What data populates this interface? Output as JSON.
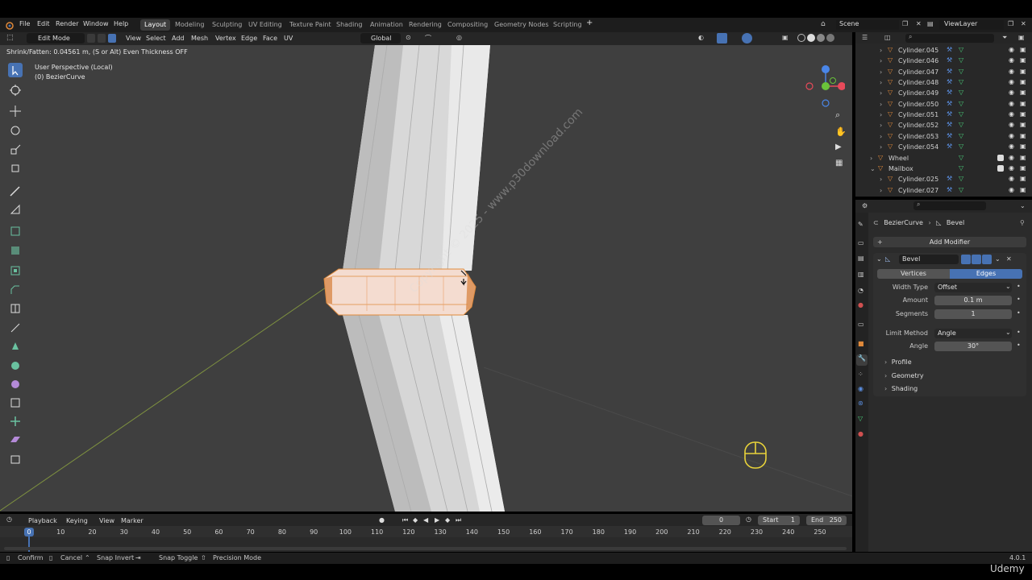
{
  "menus": [
    "File",
    "Edit",
    "Render",
    "Window",
    "Help"
  ],
  "workspace_tabs": [
    "Layout",
    "Modeling",
    "Sculpting",
    "UV Editing",
    "Texture Paint",
    "Shading",
    "Animation",
    "Rendering",
    "Compositing",
    "Geometry Nodes",
    "Scripting"
  ],
  "active_tab": "Layout",
  "scene": "Scene",
  "view_layer": "ViewLayer",
  "viewport_header": {
    "mode": "Edit Mode",
    "menus": [
      "View",
      "Select",
      "Add",
      "Mesh",
      "Vertex",
      "Edge",
      "Face",
      "UV"
    ],
    "orientation": "Global"
  },
  "operator_info": "Shrink/Fatten: 0.04561 m, (S or Alt) Even Thickness OFF",
  "viewport_info": {
    "perspective": "User Perspective (Local)",
    "object": "(0) BezierCurve"
  },
  "watermark": "Copyright © 2025 - www.p30download.com",
  "outliner": [
    {
      "name": "Cylinder.045",
      "type": "mesh"
    },
    {
      "name": "Cylinder.046",
      "type": "mesh"
    },
    {
      "name": "Cylinder.047",
      "type": "mesh"
    },
    {
      "name": "Cylinder.048",
      "type": "mesh"
    },
    {
      "name": "Cylinder.049",
      "type": "mesh"
    },
    {
      "name": "Cylinder.050",
      "type": "mesh"
    },
    {
      "name": "Cylinder.051",
      "type": "mesh"
    },
    {
      "name": "Cylinder.052",
      "type": "mesh"
    },
    {
      "name": "Cylinder.053",
      "type": "mesh"
    },
    {
      "name": "Cylinder.054",
      "type": "mesh"
    },
    {
      "name": "Wheel",
      "type": "collection"
    },
    {
      "name": "Mailbox",
      "type": "collection"
    },
    {
      "name": "Cylinder.025",
      "type": "mesh"
    },
    {
      "name": "Cylinder.027",
      "type": "mesh"
    }
  ],
  "properties": {
    "breadcrumb_object": "BezierCurve",
    "breadcrumb_modifier": "Bevel",
    "add_modifier": "Add Modifier",
    "modifier_name": "Bevel",
    "affect_vertices": "Vertices",
    "affect_edges": "Edges",
    "width_type_label": "Width Type",
    "width_type": "Offset",
    "amount_label": "Amount",
    "amount": "0.1 m",
    "segments_label": "Segments",
    "segments": "1",
    "limit_method_label": "Limit Method",
    "limit_method": "Angle",
    "angle_label": "Angle",
    "angle": "30°",
    "panels": [
      "Profile",
      "Geometry",
      "Shading"
    ]
  },
  "timeline": {
    "menus": [
      "Playback",
      "Keying",
      "View",
      "Marker"
    ],
    "current_frame": "0",
    "start_label": "Start",
    "start": "1",
    "end_label": "End",
    "end": "250",
    "frame_labels": [
      "0",
      "10",
      "20",
      "30",
      "40",
      "50",
      "60",
      "70",
      "80",
      "90",
      "100",
      "110",
      "120",
      "130",
      "140",
      "150",
      "160",
      "170",
      "180",
      "190",
      "200",
      "210",
      "220",
      "230",
      "240",
      "250"
    ]
  },
  "statusbar": {
    "confirm": "Confirm",
    "cancel": "Cancel",
    "snap_invert": "Snap Invert",
    "snap_toggle": "Snap Toggle",
    "precision_mode": "Precision Mode",
    "version": "4.0.1"
  },
  "brand": "Udemy",
  "colors": {
    "accent": "#4772b3",
    "selection": "#f0a060",
    "mesh_icon": "#e0893a",
    "modifier_icon": "#5a8ee0"
  }
}
